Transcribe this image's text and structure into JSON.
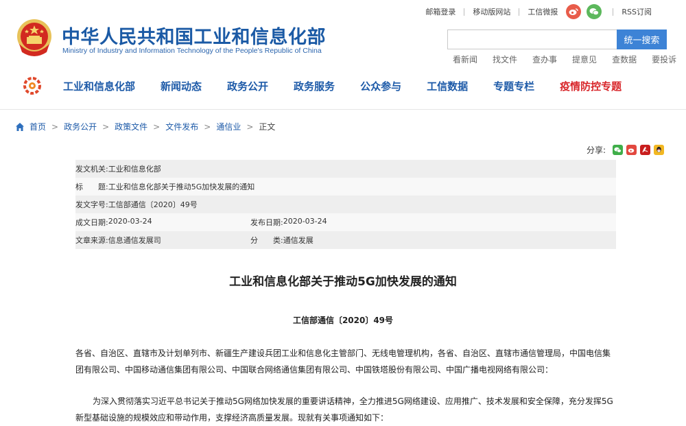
{
  "header": {
    "title": "中华人民共和国工业和信息化部",
    "subtitle": "Ministry of Industry and Information Technology of the People's Republic of China",
    "toplinks": [
      "邮箱登录",
      "移动版网站",
      "工信微报",
      "RSS订阅"
    ],
    "search": {
      "placeholder": "",
      "button": "统一搜索"
    },
    "quicklinks": [
      "看新闻",
      "找文件",
      "查办事",
      "提意见",
      "查数据",
      "要投诉"
    ]
  },
  "nav": {
    "items": [
      "工业和信息化部",
      "新闻动态",
      "政务公开",
      "政务服务",
      "公众参与",
      "工信数据",
      "专题专栏"
    ],
    "special": "疫情防控专题"
  },
  "breadcrumb": [
    "首页",
    "政务公开",
    "政策文件",
    "文件发布",
    "通信业",
    "正文"
  ],
  "share": {
    "label": "分享:"
  },
  "meta": {
    "issuer_k": "发文机关:",
    "issuer_v": "工业和信息化部",
    "title_k": "标　　题:",
    "title_v": "工业和信息化部关于推动5G加快发展的通知",
    "docno_k": "发文字号:",
    "docno_v": "工信部通信〔2020〕49号",
    "created_k": "成文日期:",
    "created_v": "2020-03-24",
    "published_k": "发布日期:",
    "published_v": "2020-03-24",
    "source_k": "文章来源:",
    "source_v": "信息通信发展司",
    "category_k": "分　　类:",
    "category_v": "通信发展"
  },
  "article": {
    "title": "工业和信息化部关于推动5G加快发展的通知",
    "doc_no": "工信部通信〔2020〕49号",
    "p1": "各省、自治区、直辖市及计划单列市、新疆生产建设兵团工业和信息化主管部门、无线电管理机构，各省、自治区、直辖市通信管理局，中国电信集团有限公司、中国移动通信集团有限公司、中国联合网络通信集团有限公司、中国铁塔股份有限公司、中国广播电视网络有限公司：",
    "p2": "为深入贯彻落实习近平总书记关于推动5G网络加快发展的重要讲话精神，全力推进5G网络建设、应用推广、技术发展和安全保障，充分发挥5G新型基础设施的规模效应和带动作用，支撑经济高质量发展。现就有关事项通知如下："
  },
  "colors": {
    "brand_blue": "#1d5aa8",
    "accent_red": "#d8262a",
    "search_blue": "#3d83d6"
  },
  "icons": [
    "national-emblem-icon",
    "weibo-icon",
    "wechat-icon",
    "nav-logo-icon",
    "home-icon",
    "wechat-share-icon",
    "weibo-share-icon",
    "pdf-icon",
    "qq-icon"
  ]
}
